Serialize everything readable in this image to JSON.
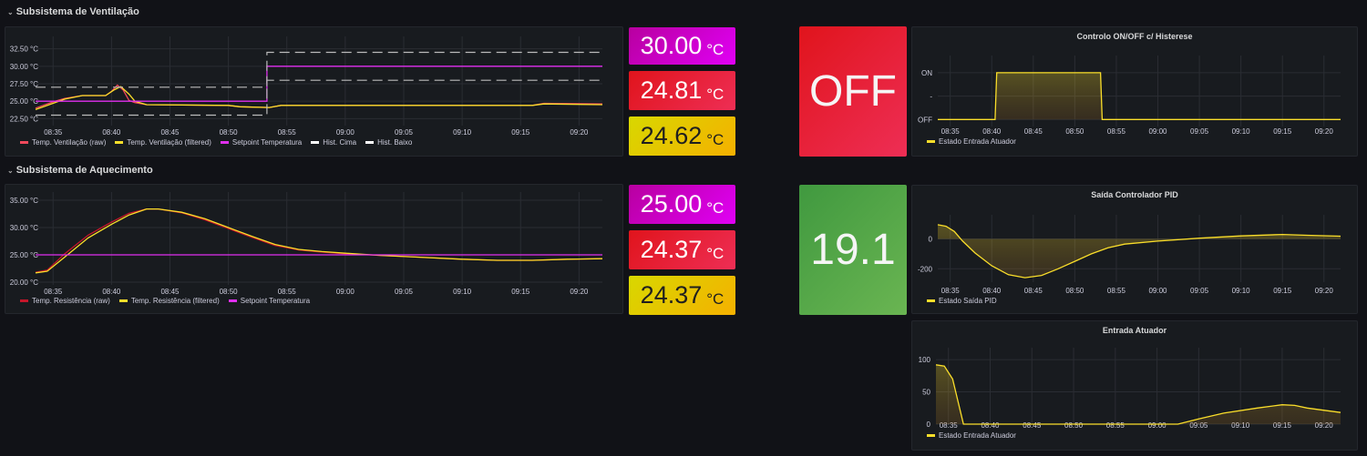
{
  "rows": [
    {
      "title": "Subsistema de Ventilação"
    },
    {
      "title": "Subsistema de Aquecimento"
    }
  ],
  "stats": {
    "vent": [
      {
        "value": "30.00",
        "unit": "°C",
        "color": "#d400e0"
      },
      {
        "value": "24.81",
        "unit": "°C",
        "color": "#e5262e"
      },
      {
        "value": "24.62",
        "unit": "°C",
        "color": "#e8c800"
      }
    ],
    "heat": [
      {
        "value": "25.00",
        "unit": "°C",
        "color": "#d400e0"
      },
      {
        "value": "24.37",
        "unit": "°C",
        "color": "#e5262e"
      },
      {
        "value": "24.37",
        "unit": "°C",
        "color": "#e8c800"
      }
    ],
    "onoff": {
      "value": "OFF",
      "color": "#e5262e"
    },
    "pid": {
      "value": "19.1",
      "color": "#56a64b"
    }
  },
  "chart_data": [
    {
      "id": "vent",
      "type": "line",
      "title": "",
      "xlim": [
        "08:33.5",
        "09:22"
      ],
      "ylim": [
        21.5,
        33.5
      ],
      "xticks": [
        "08:35",
        "08:40",
        "08:45",
        "08:50",
        "08:55",
        "09:00",
        "09:05",
        "09:10",
        "09:15",
        "09:20"
      ],
      "yticks": [
        {
          "v": 32.5,
          "label": "32.50 °C"
        },
        {
          "v": 30,
          "label": "30.00 °C"
        },
        {
          "v": 27.5,
          "label": "27.50 °C"
        },
        {
          "v": 25,
          "label": "25.00 °C"
        },
        {
          "v": 22.5,
          "label": "22.50 °C"
        }
      ],
      "series": [
        {
          "name": "Temp. Ventilação (raw)",
          "color": "#f2495c",
          "points": [
            [
              "08:33.5",
              24.0
            ],
            [
              "08:35",
              24.9
            ],
            [
              "08:36",
              25.4
            ],
            [
              "08:37.5",
              25.8
            ],
            [
              "08:39.5",
              25.8
            ],
            [
              "08:40",
              26.4
            ],
            [
              "08:40.5",
              27.3
            ],
            [
              "08:41",
              26.6
            ],
            [
              "08:41.5",
              25.1
            ],
            [
              "08:42",
              24.8
            ],
            [
              "08:43",
              24.5
            ],
            [
              "08:50",
              24.4
            ],
            [
              "08:51",
              24.2
            ],
            [
              "08:53.5",
              24.1
            ],
            [
              "08:54.5",
              24.4
            ],
            [
              "09:16",
              24.4
            ],
            [
              "09:17",
              24.7
            ],
            [
              "09:22",
              24.6
            ]
          ]
        },
        {
          "name": "Temp. Ventilação (filtered)",
          "color": "#fade2a",
          "points": [
            [
              "08:33.5",
              23.8
            ],
            [
              "08:35",
              24.7
            ],
            [
              "08:36",
              25.3
            ],
            [
              "08:37.5",
              25.8
            ],
            [
              "08:39.5",
              25.8
            ],
            [
              "08:40.2",
              26.6
            ],
            [
              "08:40.8",
              27.1
            ],
            [
              "08:41.5",
              26.0
            ],
            [
              "08:42",
              25.0
            ],
            [
              "08:43",
              24.5
            ],
            [
              "08:50",
              24.4
            ],
            [
              "08:51",
              24.2
            ],
            [
              "08:53.5",
              24.1
            ],
            [
              "08:54.5",
              24.4
            ],
            [
              "09:16",
              24.4
            ],
            [
              "09:17",
              24.6
            ],
            [
              "09:22",
              24.5
            ]
          ]
        },
        {
          "name": "Setpoint Temperatura",
          "color": "#e02fef",
          "points": [
            [
              "08:33.5",
              25
            ],
            [
              "08:53.3",
              25
            ],
            [
              "08:53.3",
              30
            ],
            [
              "09:22",
              30
            ]
          ]
        },
        {
          "name": "Hist. Cima",
          "color": "#ffffff",
          "dash": true,
          "points": [
            [
              "08:33.5",
              27
            ],
            [
              "08:53.3",
              27
            ],
            [
              "08:53.3",
              32
            ],
            [
              "09:22",
              32
            ]
          ]
        },
        {
          "name": "Hist. Baixo",
          "color": "#ffffff",
          "dash": true,
          "points": [
            [
              "08:33.5",
              23
            ],
            [
              "08:53.3",
              23
            ],
            [
              "08:53.3",
              28
            ],
            [
              "09:22",
              28
            ]
          ]
        }
      ]
    },
    {
      "id": "heat",
      "type": "line",
      "title": "",
      "xlim": [
        "08:33.5",
        "09:22"
      ],
      "ylim": [
        19.5,
        35.5
      ],
      "xticks": [
        "08:35",
        "08:40",
        "08:45",
        "08:50",
        "08:55",
        "09:00",
        "09:05",
        "09:10",
        "09:15",
        "09:20"
      ],
      "yticks": [
        {
          "v": 35,
          "label": "35.00 °C"
        },
        {
          "v": 30,
          "label": "30.00 °C"
        },
        {
          "v": 25,
          "label": "25.00 °C"
        },
        {
          "v": 20,
          "label": "20.00 °C"
        }
      ],
      "series": [
        {
          "name": "Temp. Resistência (raw)",
          "color": "#c4162a",
          "points": [
            [
              "08:33.5",
              21.8
            ],
            [
              "08:34.5",
              22.2
            ],
            [
              "08:36",
              25.2
            ],
            [
              "08:38",
              28.6
            ],
            [
              "08:40",
              31.0
            ],
            [
              "08:41.5",
              32.6
            ],
            [
              "08:43",
              33.4
            ],
            [
              "08:44",
              33.4
            ],
            [
              "08:46",
              32.7
            ],
            [
              "08:48",
              31.4
            ],
            [
              "08:50",
              29.8
            ],
            [
              "08:52",
              28.2
            ],
            [
              "08:54",
              26.7
            ],
            [
              "08:56",
              25.9
            ],
            [
              "08:58",
              25.5
            ],
            [
              "09:00",
              25.2
            ],
            [
              "09:03",
              24.9
            ],
            [
              "09:06",
              24.6
            ],
            [
              "09:10",
              24.2
            ],
            [
              "09:13",
              24.0
            ],
            [
              "09:16",
              24.0
            ],
            [
              "09:19",
              24.2
            ],
            [
              "09:22",
              24.3
            ]
          ]
        },
        {
          "name": "Temp. Resistência (filtered)",
          "color": "#fade2a",
          "points": [
            [
              "08:33.5",
              21.7
            ],
            [
              "08:34.5",
              22.0
            ],
            [
              "08:36",
              24.6
            ],
            [
              "08:38",
              28.1
            ],
            [
              "08:40",
              30.6
            ],
            [
              "08:41.5",
              32.3
            ],
            [
              "08:43",
              33.4
            ],
            [
              "08:44",
              33.4
            ],
            [
              "08:46",
              32.8
            ],
            [
              "08:48",
              31.6
            ],
            [
              "08:50",
              30.0
            ],
            [
              "08:52",
              28.4
            ],
            [
              "08:54",
              26.9
            ],
            [
              "08:56",
              26.0
            ],
            [
              "08:58",
              25.6
            ],
            [
              "09:00",
              25.3
            ],
            [
              "09:03",
              24.9
            ],
            [
              "09:06",
              24.6
            ],
            [
              "09:10",
              24.2
            ],
            [
              "09:13",
              24.0
            ],
            [
              "09:16",
              24.0
            ],
            [
              "09:19",
              24.2
            ],
            [
              "09:22",
              24.3
            ]
          ]
        },
        {
          "name": "Setpoint Temperatura",
          "color": "#e02fef",
          "points": [
            [
              "08:33.5",
              25
            ],
            [
              "09:22",
              25
            ]
          ]
        }
      ]
    },
    {
      "id": "onoff",
      "type": "area",
      "title": "Controlo ON/OFF c/ Histerese",
      "xlim": [
        "08:33.5",
        "09:22"
      ],
      "ylim": [
        -0.15,
        1.25
      ],
      "xticks": [
        "08:35",
        "08:40",
        "08:45",
        "08:50",
        "08:55",
        "09:00",
        "09:05",
        "09:10",
        "09:15",
        "09:20"
      ],
      "yticks": [
        {
          "v": 1,
          "label": "ON"
        },
        {
          "v": 0.5,
          "label": "-"
        },
        {
          "v": 0,
          "label": "OFF"
        }
      ],
      "series": [
        {
          "name": "Estado Entrada Atuador",
          "color": "#fade2a",
          "fill": true,
          "points": [
            [
              "08:33.5",
              0
            ],
            [
              "08:40.4",
              0
            ],
            [
              "08:40.6",
              1
            ],
            [
              "08:53.1",
              1
            ],
            [
              "08:53.3",
              0
            ],
            [
              "09:22",
              0
            ]
          ]
        }
      ]
    },
    {
      "id": "pid",
      "type": "area",
      "title": "Saída Controlador PID",
      "xlim": [
        "08:33.5",
        "09:22"
      ],
      "ylim": [
        -290,
        125
      ],
      "xticks": [
        "08:35",
        "08:40",
        "08:45",
        "08:50",
        "08:55",
        "09:00",
        "09:05",
        "09:10",
        "09:15",
        "09:20"
      ],
      "yticks": [
        {
          "v": 0,
          "label": "0"
        },
        {
          "v": -200,
          "label": "-200"
        }
      ],
      "series": [
        {
          "name": "Estado Saída PID",
          "color": "#fade2a",
          "fill": true,
          "points": [
            [
              "08:33.5",
              95
            ],
            [
              "08:34.5",
              85
            ],
            [
              "08:35.5",
              50
            ],
            [
              "08:36.5",
              -15
            ],
            [
              "08:38",
              -95
            ],
            [
              "08:40",
              -180
            ],
            [
              "08:42",
              -240
            ],
            [
              "08:44",
              -260
            ],
            [
              "08:46",
              -245
            ],
            [
              "08:48",
              -200
            ],
            [
              "08:50",
              -150
            ],
            [
              "08:52",
              -100
            ],
            [
              "08:54",
              -60
            ],
            [
              "08:56",
              -35
            ],
            [
              "09:00",
              -15
            ],
            [
              "09:05",
              5
            ],
            [
              "09:10",
              20
            ],
            [
              "09:15",
              30
            ],
            [
              "09:18",
              24
            ],
            [
              "09:22",
              18
            ]
          ]
        }
      ]
    },
    {
      "id": "atuador",
      "type": "area",
      "title": "Entrada Atuador",
      "xlim": [
        "08:33.5",
        "09:22"
      ],
      "ylim": [
        0,
        110
      ],
      "xticks": [
        "08:35",
        "08:40",
        "08:45",
        "08:50",
        "08:55",
        "09:00",
        "09:05",
        "09:10",
        "09:15",
        "09:20"
      ],
      "yticks": [
        {
          "v": 100,
          "label": "100"
        },
        {
          "v": 50,
          "label": "50"
        },
        {
          "v": 0,
          "label": "0"
        }
      ],
      "series": [
        {
          "name": "Estado Entrada Atuador",
          "color": "#fade2a",
          "fill": true,
          "points": [
            [
              "08:33.5",
              92
            ],
            [
              "08:34.5",
              90
            ],
            [
              "08:35.5",
              70
            ],
            [
              "08:36.8",
              0
            ],
            [
              "09:02.5",
              0
            ],
            [
              "09:05",
              8
            ],
            [
              "09:08",
              17
            ],
            [
              "09:12",
              25
            ],
            [
              "09:15",
              30
            ],
            [
              "09:16.5",
              29
            ],
            [
              "09:18",
              25
            ],
            [
              "09:22",
              18
            ]
          ]
        }
      ]
    }
  ]
}
